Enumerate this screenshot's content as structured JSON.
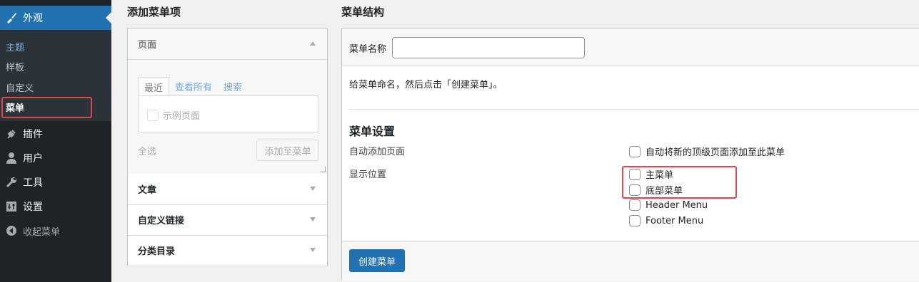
{
  "sidebar": {
    "active_item": {
      "label": "外观",
      "icon": "paintbrush-icon"
    },
    "submenu": [
      {
        "label": "主题"
      },
      {
        "label": "样板"
      },
      {
        "label": "自定义"
      },
      {
        "label": "菜单"
      }
    ],
    "items": [
      {
        "label": "插件",
        "icon": "plugin-icon"
      },
      {
        "label": "用户",
        "icon": "user-icon"
      },
      {
        "label": "工具",
        "icon": "wrench-icon"
      },
      {
        "label": "设置",
        "icon": "settings-icon"
      },
      {
        "label": "收起菜单",
        "icon": "collapse-icon"
      }
    ]
  },
  "add_menu_items": {
    "title": "添加菜单项",
    "pages": {
      "label": "页面",
      "tabs": [
        "最近",
        "查看所有",
        "搜索"
      ],
      "example_item": "示例页面",
      "select_all": "全选",
      "add_button": "添加至菜单"
    },
    "sections": [
      {
        "label": "文章"
      },
      {
        "label": "自定义链接"
      },
      {
        "label": "分类目录"
      }
    ]
  },
  "menu_structure": {
    "title": "菜单结构",
    "name_label": "菜单名称",
    "name_value": "",
    "instruction": "给菜单命名，然后点击「创建菜单」。",
    "settings_title": "菜单设置",
    "auto_add_label": "自动添加页面",
    "auto_add_option": "自动将新的顶级页面添加至此菜单",
    "location_label": "显示位置",
    "locations": [
      {
        "label": "主菜单"
      },
      {
        "label": "底部菜单"
      },
      {
        "label": "Header Menu"
      },
      {
        "label": "Footer Menu"
      }
    ],
    "create_button": "创建菜单"
  },
  "colors": {
    "accent": "#2271b1",
    "sidebar_bg": "#1d2327",
    "highlight": "#e0474c"
  }
}
